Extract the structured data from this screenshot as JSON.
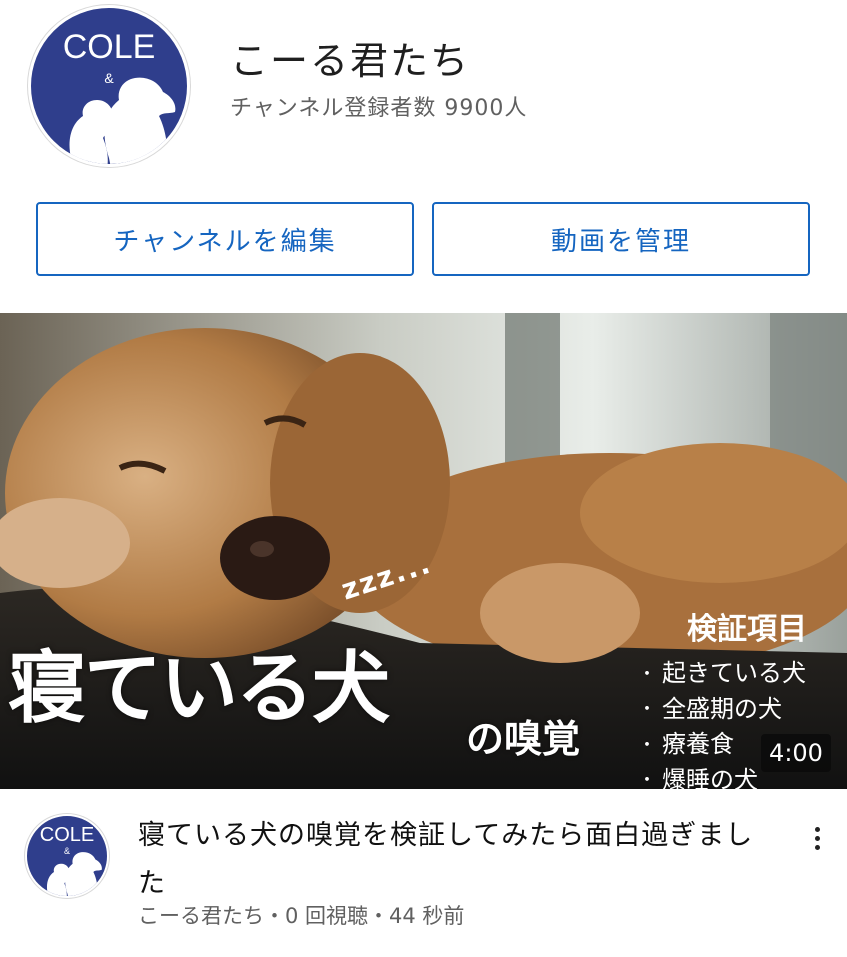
{
  "channel": {
    "title": "こーる君たち",
    "subscribers": "チャンネル登録者数 9900人",
    "avatar": {
      "name": "COLE",
      "amp": "&",
      "bg_color": "#2f3e8c"
    }
  },
  "actions": {
    "edit_label": "チャンネルを編集",
    "manage_label": "動画を管理",
    "accent_color": "#1565c0"
  },
  "video": {
    "thumbnail": {
      "big_text": "寝ている犬",
      "small_text": "の嗅覚",
      "zzz": "zzz...",
      "checklist_heading": "検証項目",
      "checklist": [
        "起きている犬",
        "全盛期の犬",
        "療養食",
        "爆睡の犬"
      ],
      "bullet": "・",
      "duration": "4:00"
    },
    "title": "寝ている犬の嗅覚を検証してみたら面白過ぎました",
    "meta": "こーる君たち・0 回視聴・44 秒前",
    "menu_icon": "more-vert-icon"
  }
}
